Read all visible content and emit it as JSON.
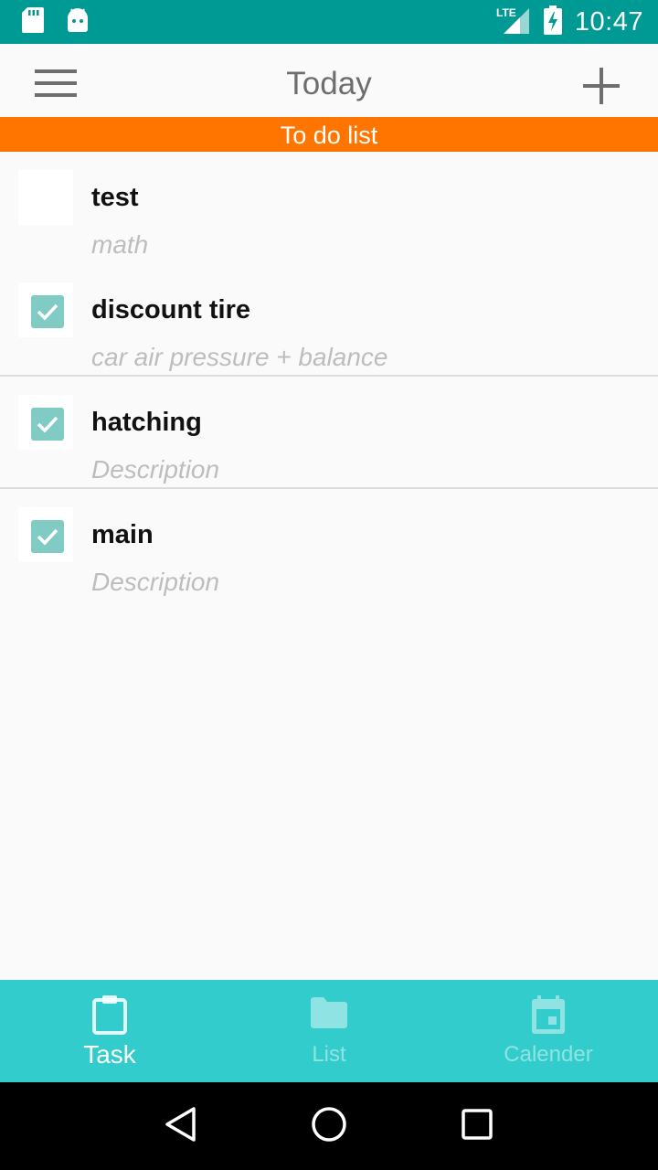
{
  "status_bar": {
    "time": "10:47",
    "network_label": "LTE",
    "icons": [
      "sd-card-icon",
      "android-icon",
      "lte-signal-icon",
      "battery-charging-icon"
    ]
  },
  "app_bar": {
    "title": "Today",
    "menu_icon": "hamburger-menu-icon",
    "add_icon": "plus-icon"
  },
  "banner": {
    "label": "To do list",
    "color": "#ff7500"
  },
  "tasks": [
    {
      "title": "test",
      "description": "math",
      "checked": false
    },
    {
      "title": "discount tire",
      "description": "car air pressure + balance",
      "checked": true
    },
    {
      "title": "hatching",
      "description": "Description",
      "checked": true
    },
    {
      "title": "main",
      "description": "Description",
      "checked": true
    }
  ],
  "bottom_nav": {
    "items": [
      {
        "label": "Task",
        "icon": "clipboard-icon",
        "active": true
      },
      {
        "label": "List",
        "icon": "folder-icon",
        "active": false
      },
      {
        "label": "Calender",
        "icon": "calendar-icon",
        "active": false
      }
    ],
    "color": "#33cccc"
  },
  "system_nav": {
    "icons": [
      "back-icon",
      "home-icon",
      "recents-icon"
    ]
  }
}
